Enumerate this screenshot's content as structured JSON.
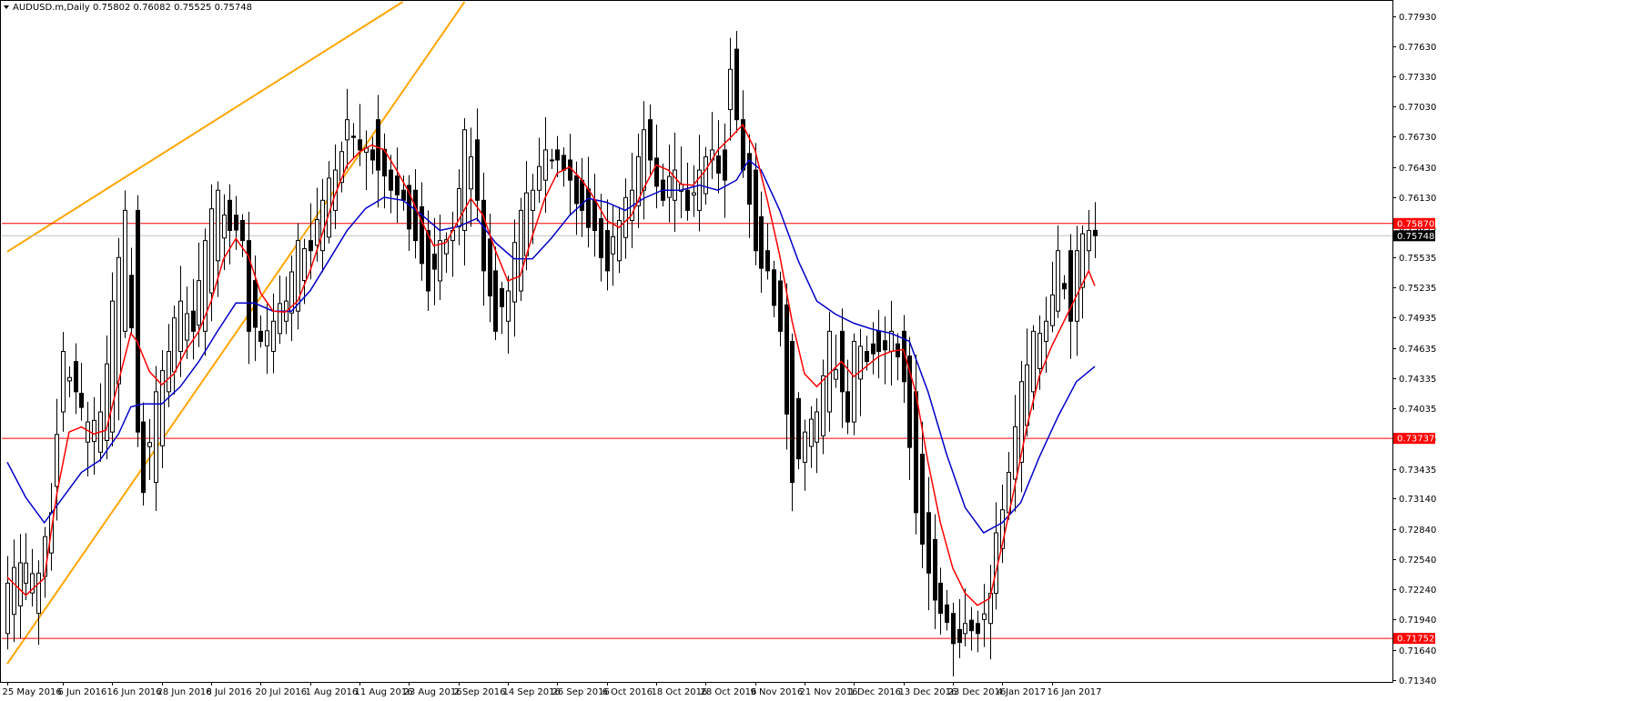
{
  "chart_info": {
    "symbol": "AUDUSD.m,Daily",
    "ohlc": "0.75802 0.76082 0.75525 0.75748"
  },
  "colors": {
    "background": "#ffffff",
    "axis": "#000000",
    "candle_up_fill": "#ffffff",
    "candle_down_fill": "#000000",
    "candle_outline": "#000000",
    "ma_fast": "#ff0000",
    "ma_slow": "#0000cc",
    "trendline": "#ffa500",
    "hline": "#ff0000",
    "current_price_line": "#c0c0c0",
    "current_price_tag": "#000000"
  },
  "chart_data": {
    "type": "candlestick",
    "ylim": [
      0.7132,
      0.7807
    ],
    "y_ticks": [
      0.7793,
      0.7763,
      0.7733,
      0.7703,
      0.7673,
      0.7643,
      0.7613,
      0.75835,
      0.75535,
      0.75235,
      0.74935,
      0.74635,
      0.74335,
      0.74035,
      0.73735,
      0.73435,
      0.7314,
      0.7284,
      0.7254,
      0.7224,
      0.7194,
      0.7164,
      0.7134
    ],
    "x_labels": [
      {
        "i": 0,
        "label": "25 May 2016"
      },
      {
        "i": 9,
        "label": "6 Jun 2016"
      },
      {
        "i": 17,
        "label": "16 Jun 2016"
      },
      {
        "i": 25,
        "label": "28 Jun 2016"
      },
      {
        "i": 33,
        "label": "8 Jul 2016"
      },
      {
        "i": 41,
        "label": "20 Jul 2016"
      },
      {
        "i": 49,
        "label": "1 Aug 2016"
      },
      {
        "i": 57,
        "label": "11 Aug 2016"
      },
      {
        "i": 65,
        "label": "23 Aug 2016"
      },
      {
        "i": 73,
        "label": "2 Sep 2016"
      },
      {
        "i": 81,
        "label": "14 Sep 2016"
      },
      {
        "i": 89,
        "label": "26 Sep 2016"
      },
      {
        "i": 97,
        "label": "6 Oct 2016"
      },
      {
        "i": 105,
        "label": "18 Oct 2016"
      },
      {
        "i": 113,
        "label": "28 Oct 2016"
      },
      {
        "i": 121,
        "label": "9 Nov 2016"
      },
      {
        "i": 129,
        "label": "21 Nov 2016"
      },
      {
        "i": 137,
        "label": "1 Dec 2016"
      },
      {
        "i": 145,
        "label": "13 Dec 2016"
      },
      {
        "i": 153,
        "label": "23 Dec 2016"
      },
      {
        "i": 161,
        "label": "4 Jan 2017"
      },
      {
        "i": 169,
        "label": "16 Jan 2017"
      }
    ],
    "anchors": [
      [
        0,
        0.718,
        0.723
      ],
      [
        3,
        0.723,
        0.725
      ],
      [
        5,
        0.72,
        0.724
      ],
      [
        7,
        0.726,
        0.73
      ],
      [
        9,
        0.74,
        0.746
      ],
      [
        11,
        0.745,
        0.742
      ],
      [
        13,
        0.737,
        0.739
      ],
      [
        15,
        0.736,
        0.74
      ],
      [
        17,
        0.738,
        0.751
      ],
      [
        19,
        0.748,
        0.76
      ],
      [
        21,
        0.76,
        0.738
      ],
      [
        22,
        0.739,
        0.732
      ],
      [
        24,
        0.733,
        0.742
      ],
      [
        26,
        0.742,
        0.746
      ],
      [
        28,
        0.746,
        0.751
      ],
      [
        30,
        0.75,
        0.748
      ],
      [
        32,
        0.748,
        0.757
      ],
      [
        34,
        0.755,
        0.762
      ],
      [
        36,
        0.761,
        0.758
      ],
      [
        38,
        0.759,
        0.757
      ],
      [
        39,
        0.757,
        0.748
      ],
      [
        41,
        0.748,
        0.747
      ],
      [
        43,
        0.746,
        0.749
      ],
      [
        45,
        0.749,
        0.751
      ],
      [
        47,
        0.75,
        0.757
      ],
      [
        49,
        0.757,
        0.756
      ],
      [
        51,
        0.756,
        0.761
      ],
      [
        53,
        0.76,
        0.764
      ],
      [
        55,
        0.767,
        0.769
      ],
      [
        57,
        0.767,
        0.766
      ],
      [
        59,
        0.766,
        0.765
      ],
      [
        60,
        0.769,
        0.764
      ],
      [
        62,
        0.764,
        0.762
      ],
      [
        64,
        0.762,
        0.761
      ],
      [
        66,
        0.762,
        0.757
      ],
      [
        68,
        0.758,
        0.752
      ],
      [
        70,
        0.753,
        0.757
      ],
      [
        72,
        0.757,
        0.758
      ],
      [
        74,
        0.758,
        0.768
      ],
      [
        76,
        0.767,
        0.761
      ],
      [
        77,
        0.761,
        0.754
      ],
      [
        79,
        0.754,
        0.748
      ],
      [
        81,
        0.749,
        0.752
      ],
      [
        83,
        0.752,
        0.76
      ],
      [
        85,
        0.76,
        0.762
      ],
      [
        87,
        0.763,
        0.766
      ],
      [
        89,
        0.766,
        0.765
      ],
      [
        91,
        0.765,
        0.763
      ],
      [
        93,
        0.763,
        0.76
      ],
      [
        95,
        0.761,
        0.758
      ],
      [
        97,
        0.758,
        0.754
      ],
      [
        99,
        0.755,
        0.759
      ],
      [
        101,
        0.759,
        0.762
      ],
      [
        103,
        0.762,
        0.768
      ],
      [
        104,
        0.769,
        0.765
      ],
      [
        106,
        0.763,
        0.761
      ],
      [
        108,
        0.761,
        0.764
      ],
      [
        110,
        0.762,
        0.76
      ],
      [
        112,
        0.76,
        0.764
      ],
      [
        114,
        0.765,
        0.766
      ],
      [
        116,
        0.766,
        0.763
      ],
      [
        117,
        0.77,
        0.774
      ],
      [
        118,
        0.776,
        0.769
      ],
      [
        119,
        0.769,
        0.764
      ],
      [
        121,
        0.764,
        0.756
      ],
      [
        123,
        0.756,
        0.754
      ],
      [
        125,
        0.753,
        0.748
      ],
      [
        127,
        0.747,
        0.733
      ],
      [
        129,
        0.735,
        0.738
      ],
      [
        131,
        0.737,
        0.74
      ],
      [
        133,
        0.74,
        0.748
      ],
      [
        135,
        0.748,
        0.742
      ],
      [
        136,
        0.742,
        0.739
      ],
      [
        137,
        0.739,
        0.747
      ],
      [
        139,
        0.746,
        0.745
      ],
      [
        141,
        0.748,
        0.746
      ],
      [
        143,
        0.746,
        0.748
      ],
      [
        145,
        0.748,
        0.743
      ],
      [
        147,
        0.742,
        0.73
      ],
      [
        149,
        0.73,
        0.724
      ],
      [
        151,
        0.723,
        0.72
      ],
      [
        153,
        0.72,
        0.717
      ],
      [
        155,
        0.718,
        0.719
      ],
      [
        157,
        0.719,
        0.718
      ],
      [
        159,
        0.719,
        0.722
      ],
      [
        160,
        0.722,
        0.728
      ],
      [
        162,
        0.73,
        0.734
      ],
      [
        164,
        0.735,
        0.743
      ],
      [
        166,
        0.742,
        0.748
      ],
      [
        168,
        0.747,
        0.749
      ],
      [
        170,
        0.75,
        0.756
      ],
      [
        172,
        0.756,
        0.749
      ],
      [
        173,
        0.749,
        0.756
      ],
      [
        175,
        0.756,
        0.758
      ],
      [
        176,
        0.758,
        0.75748
      ]
    ],
    "ma_fast_points": [
      [
        0,
        0.7236
      ],
      [
        3,
        0.7218
      ],
      [
        6,
        0.7235
      ],
      [
        8,
        0.7318
      ],
      [
        10,
        0.738
      ],
      [
        12,
        0.7385
      ],
      [
        14,
        0.7378
      ],
      [
        16,
        0.7382
      ],
      [
        18,
        0.743
      ],
      [
        20,
        0.7478
      ],
      [
        21,
        0.747
      ],
      [
        23,
        0.744
      ],
      [
        25,
        0.7427
      ],
      [
        27,
        0.7438
      ],
      [
        29,
        0.7462
      ],
      [
        31,
        0.748
      ],
      [
        33,
        0.751
      ],
      [
        35,
        0.7552
      ],
      [
        37,
        0.7572
      ],
      [
        39,
        0.7555
      ],
      [
        41,
        0.7518
      ],
      [
        43,
        0.75
      ],
      [
        45,
        0.7499
      ],
      [
        47,
        0.751
      ],
      [
        49,
        0.754
      ],
      [
        51,
        0.7577
      ],
      [
        53,
        0.7615
      ],
      [
        55,
        0.7645
      ],
      [
        57,
        0.7658
      ],
      [
        59,
        0.7665
      ],
      [
        61,
        0.766
      ],
      [
        63,
        0.764
      ],
      [
        65,
        0.7618
      ],
      [
        67,
        0.759
      ],
      [
        69,
        0.7565
      ],
      [
        71,
        0.7568
      ],
      [
        73,
        0.759
      ],
      [
        75,
        0.7612
      ],
      [
        77,
        0.7595
      ],
      [
        79,
        0.756
      ],
      [
        81,
        0.753
      ],
      [
        83,
        0.7535
      ],
      [
        85,
        0.7575
      ],
      [
        87,
        0.7612
      ],
      [
        89,
        0.7637
      ],
      [
        91,
        0.7643
      ],
      [
        93,
        0.763
      ],
      [
        95,
        0.7612
      ],
      [
        97,
        0.759
      ],
      [
        99,
        0.7583
      ],
      [
        101,
        0.7595
      ],
      [
        103,
        0.7622
      ],
      [
        105,
        0.7645
      ],
      [
        107,
        0.764
      ],
      [
        109,
        0.7626
      ],
      [
        111,
        0.7625
      ],
      [
        113,
        0.764
      ],
      [
        115,
        0.766
      ],
      [
        117,
        0.7672
      ],
      [
        119,
        0.7685
      ],
      [
        121,
        0.766
      ],
      [
        123,
        0.761
      ],
      [
        125,
        0.7555
      ],
      [
        127,
        0.749
      ],
      [
        129,
        0.7438
      ],
      [
        131,
        0.7425
      ],
      [
        133,
        0.7438
      ],
      [
        135,
        0.745
      ],
      [
        137,
        0.7435
      ],
      [
        139,
        0.7445
      ],
      [
        141,
        0.7455
      ],
      [
        143,
        0.746
      ],
      [
        145,
        0.7462
      ],
      [
        147,
        0.742
      ],
      [
        149,
        0.735
      ],
      [
        151,
        0.729
      ],
      [
        153,
        0.7245
      ],
      [
        155,
        0.722
      ],
      [
        157,
        0.7208
      ],
      [
        159,
        0.7215
      ],
      [
        161,
        0.7268
      ],
      [
        163,
        0.7325
      ],
      [
        165,
        0.7385
      ],
      [
        167,
        0.7435
      ],
      [
        169,
        0.7465
      ],
      [
        171,
        0.749
      ],
      [
        173,
        0.7515
      ],
      [
        175,
        0.754
      ],
      [
        176,
        0.7525
      ]
    ],
    "ma_slow_points": [
      [
        0,
        0.735
      ],
      [
        3,
        0.7315
      ],
      [
        6,
        0.729
      ],
      [
        9,
        0.7315
      ],
      [
        12,
        0.734
      ],
      [
        15,
        0.7352
      ],
      [
        18,
        0.7378
      ],
      [
        20,
        0.7405
      ],
      [
        22,
        0.7408
      ],
      [
        25,
        0.7408
      ],
      [
        28,
        0.7425
      ],
      [
        31,
        0.745
      ],
      [
        34,
        0.748
      ],
      [
        37,
        0.7508
      ],
      [
        40,
        0.7508
      ],
      [
        43,
        0.75
      ],
      [
        46,
        0.75
      ],
      [
        49,
        0.752
      ],
      [
        52,
        0.755
      ],
      [
        55,
        0.758
      ],
      [
        58,
        0.7602
      ],
      [
        61,
        0.7613
      ],
      [
        64,
        0.761
      ],
      [
        67,
        0.7596
      ],
      [
        70,
        0.758
      ],
      [
        73,
        0.7584
      ],
      [
        76,
        0.7592
      ],
      [
        79,
        0.7568
      ],
      [
        82,
        0.7552
      ],
      [
        85,
        0.7552
      ],
      [
        88,
        0.7572
      ],
      [
        91,
        0.7595
      ],
      [
        94,
        0.7612
      ],
      [
        97,
        0.7608
      ],
      [
        100,
        0.76
      ],
      [
        103,
        0.7612
      ],
      [
        106,
        0.762
      ],
      [
        109,
        0.762
      ],
      [
        112,
        0.7625
      ],
      [
        115,
        0.762
      ],
      [
        118,
        0.763
      ],
      [
        120,
        0.765
      ],
      [
        122,
        0.764
      ],
      [
        125,
        0.76
      ],
      [
        128,
        0.755
      ],
      [
        131,
        0.751
      ],
      [
        134,
        0.7497
      ],
      [
        137,
        0.7488
      ],
      [
        140,
        0.7482
      ],
      [
        143,
        0.7478
      ],
      [
        146,
        0.747
      ],
      [
        149,
        0.742
      ],
      [
        152,
        0.7358
      ],
      [
        155,
        0.7305
      ],
      [
        158,
        0.728
      ],
      [
        161,
        0.729
      ],
      [
        164,
        0.731
      ],
      [
        167,
        0.7355
      ],
      [
        170,
        0.7395
      ],
      [
        173,
        0.743
      ],
      [
        176,
        0.7445
      ]
    ],
    "trendlines": [
      {
        "i1": 0,
        "p1": 0.7559,
        "i2": 64,
        "p2": 0.7807
      },
      {
        "i1": 0,
        "p1": 0.715,
        "i2": 74,
        "p2": 0.7807
      }
    ],
    "hlines": [
      {
        "price": 0.7587,
        "label": "0.75870"
      },
      {
        "price": 0.73737,
        "label": "0.73737"
      },
      {
        "price": 0.71752,
        "label": "0.71752"
      }
    ],
    "current_price": {
      "price": 0.75748,
      "label": "0.75748"
    }
  }
}
